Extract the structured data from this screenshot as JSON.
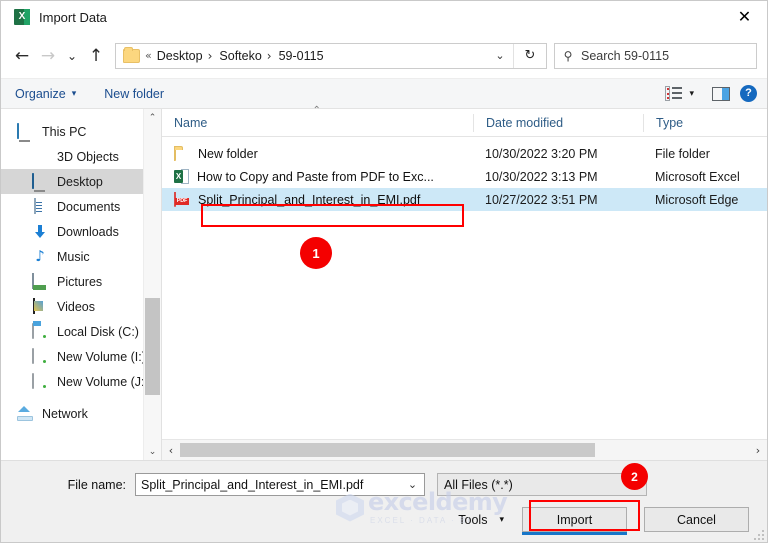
{
  "window": {
    "title": "Import Data",
    "app_icon": "excel-icon",
    "close_label": "✕"
  },
  "nav": {
    "back": "←",
    "forward": "→",
    "recent": "⌄",
    "up": "↑",
    "refresh": "↻",
    "dropdown": "⌄",
    "breadcrumb_prefix": "«",
    "breadcrumbs": [
      "Desktop",
      "Softeko",
      "59-0115"
    ],
    "separator": "›"
  },
  "search": {
    "placeholder": "Search 59-0115",
    "icon": "search-icon"
  },
  "command_bar": {
    "organize": "Organize",
    "organize_caret": "▾",
    "new_folder": "New folder",
    "view_caret": "▾",
    "help": "?"
  },
  "sidebar": {
    "items": [
      {
        "label": "This PC",
        "icon": "computer-icon",
        "indent": false,
        "selected": false
      },
      {
        "label": "3D Objects",
        "icon": "cube-icon",
        "indent": true,
        "selected": false
      },
      {
        "label": "Desktop",
        "icon": "desktop-icon",
        "indent": true,
        "selected": true
      },
      {
        "label": "Documents",
        "icon": "documents-icon",
        "indent": true,
        "selected": false
      },
      {
        "label": "Downloads",
        "icon": "download-icon",
        "indent": true,
        "selected": false
      },
      {
        "label": "Music",
        "icon": "music-icon",
        "indent": true,
        "selected": false
      },
      {
        "label": "Pictures",
        "icon": "pictures-icon",
        "indent": true,
        "selected": false
      },
      {
        "label": "Videos",
        "icon": "videos-icon",
        "indent": true,
        "selected": false
      },
      {
        "label": "Local Disk (C:)",
        "icon": "local-disk-icon",
        "indent": true,
        "selected": false
      },
      {
        "label": "New Volume (I:)",
        "icon": "drive-icon",
        "indent": true,
        "selected": false
      },
      {
        "label": "New Volume (J:)",
        "icon": "drive-icon",
        "indent": true,
        "selected": false
      },
      {
        "label": "Network",
        "icon": "network-icon",
        "indent": false,
        "selected": false
      }
    ],
    "scroll_up": "⌃",
    "scroll_down": "⌄"
  },
  "file_list": {
    "columns": [
      "Name",
      "Date modified",
      "Type"
    ],
    "sort_indicator": "⌃",
    "rows": [
      {
        "name": "New folder",
        "icon": "folder-icon",
        "date_modified": "10/30/2022 3:20 PM",
        "type": "File folder",
        "selected": false
      },
      {
        "name": "How to Copy and Paste from PDF to Exc...",
        "icon": "excel-file-icon",
        "date_modified": "10/30/2022 3:13 PM",
        "type": "Microsoft Excel",
        "selected": false
      },
      {
        "name": "Split_Principal_and_Interest_in_EMI.pdf",
        "icon": "pdf-file-icon",
        "date_modified": "10/27/2022 3:51 PM",
        "type": "Microsoft Edge",
        "selected": true
      }
    ],
    "hscroll_left": "‹",
    "hscroll_right": "›"
  },
  "footer": {
    "file_name_label": "File name:",
    "file_name_value": "Split_Principal_and_Interest_in_EMI.pdf",
    "file_name_caret": "⌄",
    "filter_value": "All Files (*.*)",
    "filter_caret": "⌄",
    "tools_label": "Tools",
    "tools_caret": "▾",
    "import_label": "Import",
    "cancel_label": "Cancel"
  },
  "annotations": {
    "badge_one": "1",
    "badge_two": "2",
    "highlight_color": "#ff0000"
  },
  "watermark": {
    "main": "exceldemy",
    "sub": "EXCEL · DATA · BI"
  }
}
